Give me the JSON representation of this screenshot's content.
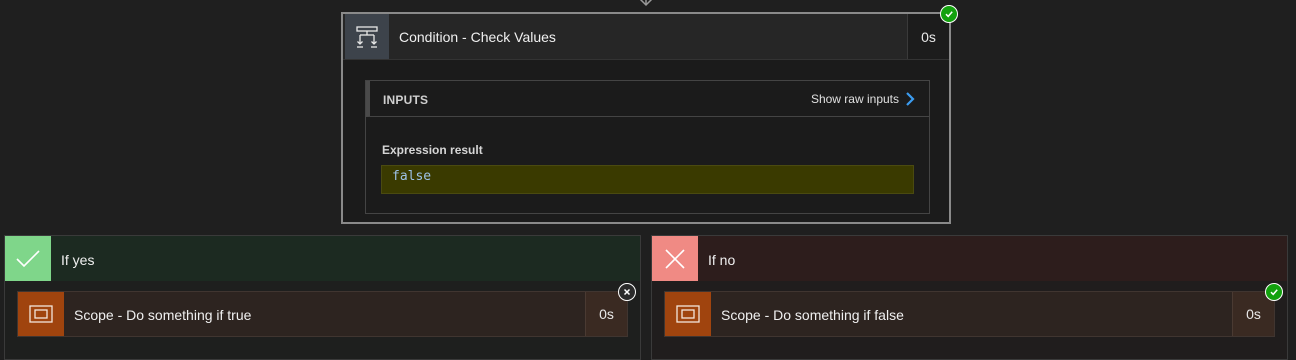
{
  "condition": {
    "icon": "condition-icon",
    "title": "Condition - Check Values",
    "duration": "0s",
    "status": "succeeded",
    "inputs": {
      "section_label": "INPUTS",
      "raw_link_label": "Show raw inputs",
      "expression_label": "Expression result",
      "expression_value": "false"
    }
  },
  "branches": {
    "yes": {
      "icon": "checkmark-icon",
      "label": "If yes",
      "accent": "#7fd68a",
      "scope": {
        "icon": "scope-icon",
        "title": "Scope - Do something if true",
        "duration": "0s",
        "status": "skipped"
      }
    },
    "no": {
      "icon": "cross-icon",
      "label": "If no",
      "accent": "#f08a84",
      "scope": {
        "icon": "scope-icon",
        "title": "Scope - Do something if false",
        "duration": "0s",
        "status": "succeeded"
      }
    }
  },
  "colors": {
    "success": "#13a10e",
    "link_chevron": "#3b9cf0",
    "scope_accent": "#a0440e",
    "expression_bg": "#3a3a00"
  }
}
